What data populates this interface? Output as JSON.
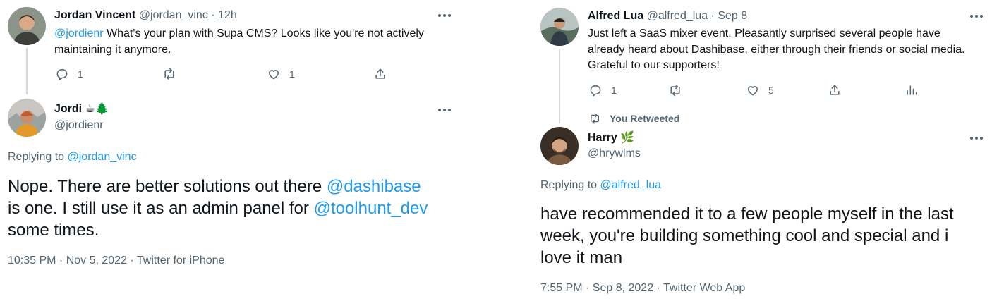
{
  "left": {
    "parent": {
      "name": "Jordan Vincent",
      "handle": "@jordan_vinc",
      "time": "· 12h",
      "mention": "@jordienr",
      "text_rest": " What's your plan with Supa CMS? Looks like you're not actively",
      "text_line2": "maintaining it anymore.",
      "reply_count": "1",
      "like_count": "1"
    },
    "reply": {
      "name": "Jordi",
      "name_emoji": "☕🌲",
      "handle": "@jordienr",
      "replying_label": "Replying to",
      "replying_handle": "@jordan_vinc",
      "line1_text": "Nope. There are better solutions out there ",
      "line1_mention": "@dashibase",
      "line2_text": "is one. I still use it as an admin panel for ",
      "line2_mention": "@toolhunt_dev",
      "line3_text": "some times.",
      "footer": "10:35 PM · Nov 5, 2022 · Twitter for iPhone"
    }
  },
  "right": {
    "parent": {
      "name": "Alfred Lua",
      "handle": "@alfred_lua",
      "time": "· Sep 8",
      "line1": "Just left a SaaS mixer event. Pleasantly surprised several people have",
      "line2": "already heard about Dashibase, either through their friends or social media.",
      "line3": "Grateful to our supporters!",
      "reply_count": "1",
      "like_count": "5"
    },
    "retweet_label": "You Retweeted",
    "reply": {
      "name": "Harry",
      "name_emoji": "🌿",
      "handle": "@hrywlms",
      "replying_label": "Replying to",
      "replying_handle": "@alfred_lua",
      "line1": "have recommended it to a few people myself in the last",
      "line2": "week, you're building something cool and special and i",
      "line3": "love it man",
      "footer": "7:55 PM · Sep 8, 2022 · Twitter Web App"
    }
  },
  "icons": [
    "reply-icon",
    "retweet-icon",
    "like-icon",
    "share-icon",
    "analytics-icon",
    "more-icon"
  ],
  "colors": {
    "accent": "#1d9bf0",
    "muted": "#536471",
    "text": "#0f1419",
    "thread": "#cfd9de"
  }
}
